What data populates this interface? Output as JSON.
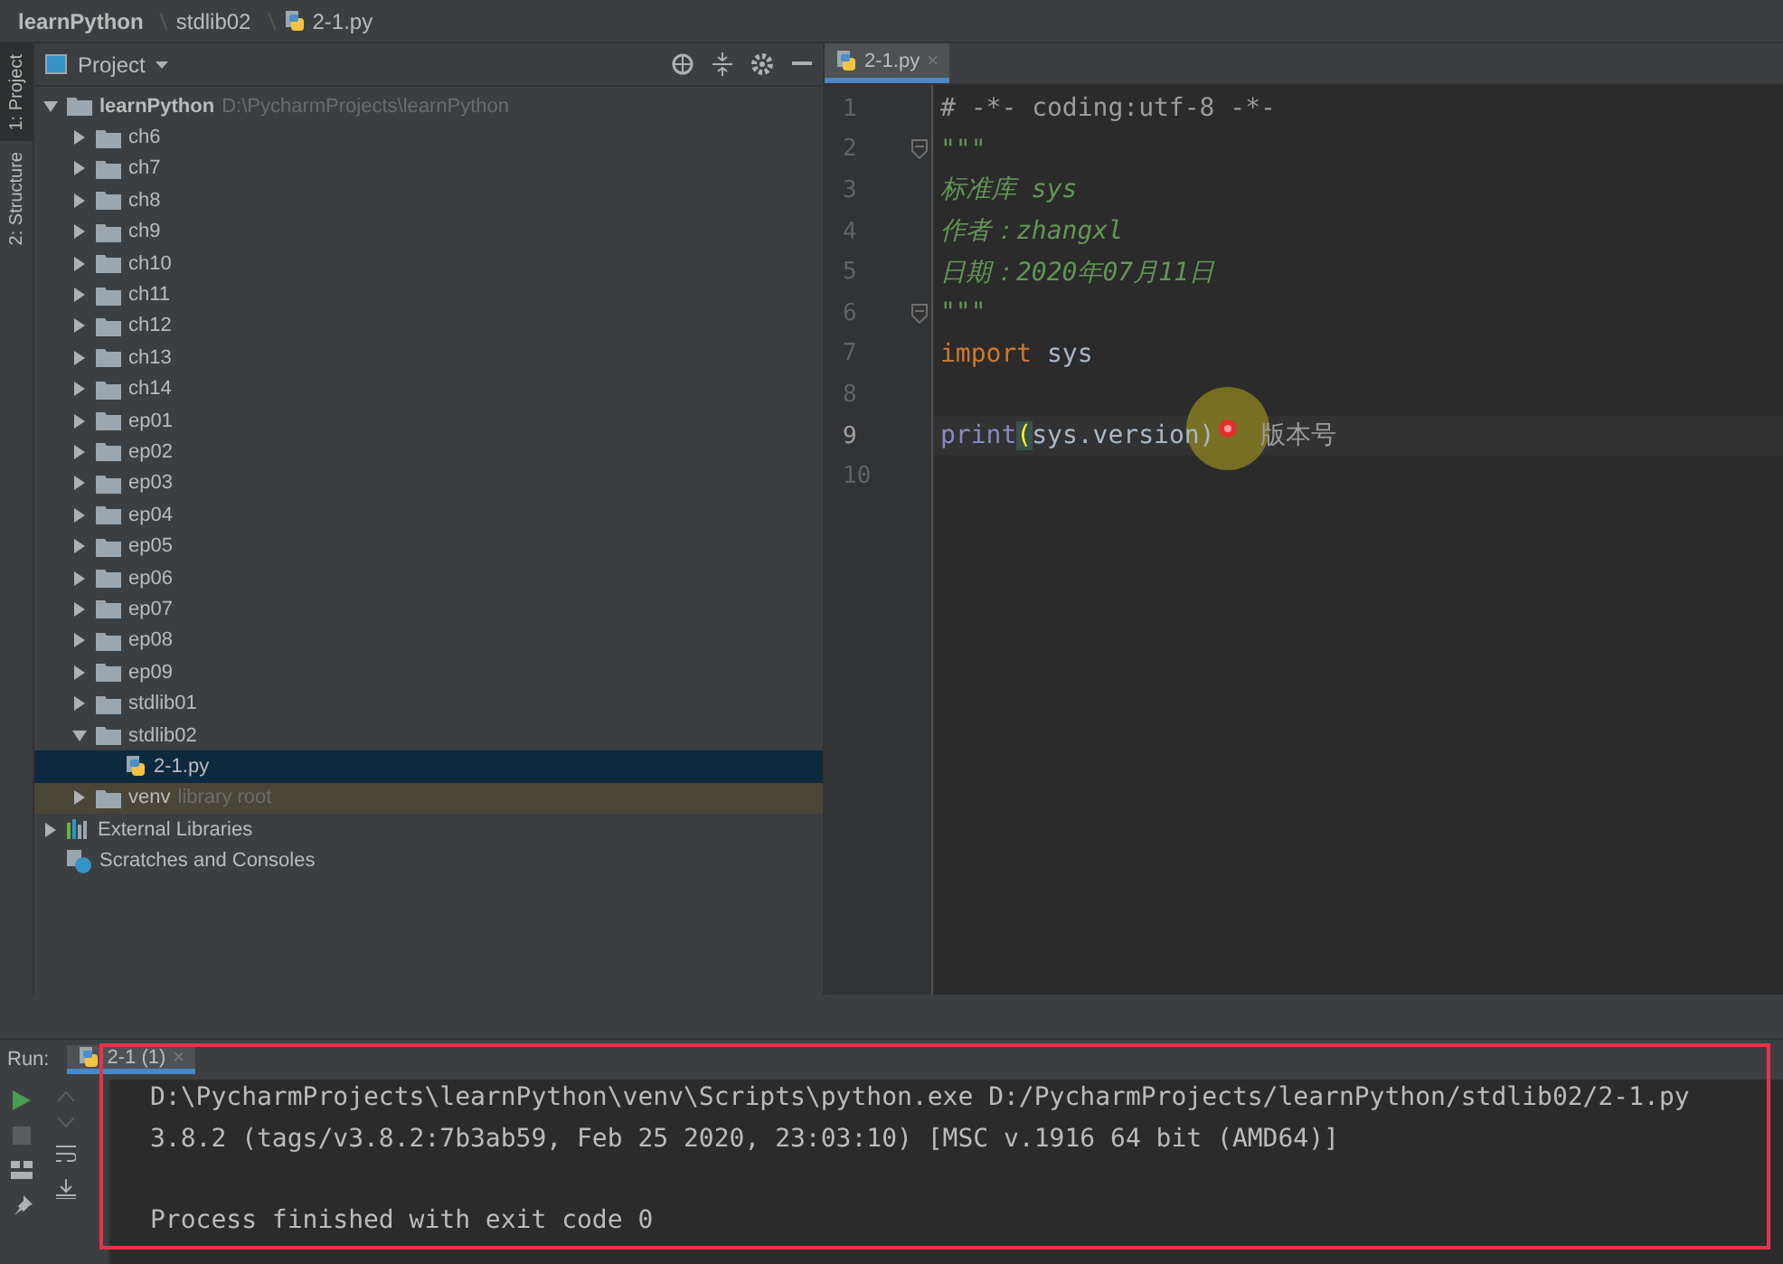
{
  "breadcrumbs": [
    {
      "label": "learnPython",
      "kind": "folder"
    },
    {
      "label": "stdlib02",
      "kind": "folder"
    },
    {
      "label": "2-1.py",
      "kind": "python-file"
    }
  ],
  "tool_strip": [
    {
      "label": "1: Project",
      "selected": true
    },
    {
      "label": "2: Structure",
      "selected": false
    }
  ],
  "project_panel": {
    "title": "Project",
    "tree": [
      {
        "label": "learnPython",
        "note": "D:\\PycharmProjects\\learnPython",
        "kind": "folder",
        "expanded": true,
        "selected": false,
        "bold": true,
        "children": [
          {
            "label": "ch6",
            "kind": "folder",
            "expanded": false,
            "selected": false
          },
          {
            "label": "ch7",
            "kind": "folder",
            "expanded": false,
            "selected": false
          },
          {
            "label": "ch8",
            "kind": "folder",
            "expanded": false,
            "selected": false
          },
          {
            "label": "ch9",
            "kind": "folder",
            "expanded": false,
            "selected": false
          },
          {
            "label": "ch10",
            "kind": "folder",
            "expanded": false,
            "selected": false
          },
          {
            "label": "ch11",
            "kind": "folder",
            "expanded": false,
            "selected": false
          },
          {
            "label": "ch12",
            "kind": "folder",
            "expanded": false,
            "selected": false
          },
          {
            "label": "ch13",
            "kind": "folder",
            "expanded": false,
            "selected": false
          },
          {
            "label": "ch14",
            "kind": "folder",
            "expanded": false,
            "selected": false
          },
          {
            "label": "ep01",
            "kind": "folder",
            "expanded": false,
            "selected": false
          },
          {
            "label": "ep02",
            "kind": "folder",
            "expanded": false,
            "selected": false
          },
          {
            "label": "ep03",
            "kind": "folder",
            "expanded": false,
            "selected": false
          },
          {
            "label": "ep04",
            "kind": "folder",
            "expanded": false,
            "selected": false
          },
          {
            "label": "ep05",
            "kind": "folder",
            "expanded": false,
            "selected": false
          },
          {
            "label": "ep06",
            "kind": "folder",
            "expanded": false,
            "selected": false
          },
          {
            "label": "ep07",
            "kind": "folder",
            "expanded": false,
            "selected": false
          },
          {
            "label": "ep08",
            "kind": "folder",
            "expanded": false,
            "selected": false
          },
          {
            "label": "ep09",
            "kind": "folder",
            "expanded": false,
            "selected": false
          },
          {
            "label": "stdlib01",
            "kind": "folder",
            "expanded": false,
            "selected": false
          },
          {
            "label": "stdlib02",
            "kind": "folder",
            "expanded": true,
            "selected": false,
            "children": [
              {
                "label": "2-1.py",
                "kind": "python-file",
                "selected": true
              }
            ]
          },
          {
            "label": "venv",
            "note": "library root",
            "kind": "library-folder",
            "expanded": false,
            "selected": false
          }
        ]
      },
      {
        "label": "External Libraries",
        "kind": "libraries",
        "expanded": false,
        "selected": false
      },
      {
        "label": "Scratches and Consoles",
        "kind": "scratches",
        "selected": false
      }
    ]
  },
  "editor": {
    "tabs": [
      {
        "label": "2-1.py",
        "selected": true,
        "close": "×"
      }
    ],
    "lines": [
      {
        "number": "1",
        "fold": false,
        "current": false,
        "tokens": [
          {
            "text": "# -*- coding:utf-8 -*-",
            "kind": "comment"
          }
        ]
      },
      {
        "number": "2",
        "fold": true,
        "current": false,
        "tokens": [
          {
            "text": "\"\"\"",
            "kind": "docstring"
          }
        ]
      },
      {
        "number": "3",
        "fold": false,
        "current": false,
        "tokens": [
          {
            "text": "标准库 sys",
            "kind": "docstring"
          }
        ]
      },
      {
        "number": "4",
        "fold": false,
        "current": false,
        "tokens": [
          {
            "text": "作者：zhangxl",
            "kind": "docstring"
          }
        ]
      },
      {
        "number": "5",
        "fold": false,
        "current": false,
        "tokens": [
          {
            "text": "日期：2020年07月11日",
            "kind": "docstring"
          }
        ]
      },
      {
        "number": "6",
        "fold": true,
        "current": false,
        "tokens": [
          {
            "text": "\"\"\"",
            "kind": "docstring"
          }
        ]
      },
      {
        "number": "7",
        "fold": false,
        "current": false,
        "tokens": [
          {
            "text": "import",
            "kind": "keyword"
          },
          {
            "text": " sys",
            "kind": "plain"
          }
        ]
      },
      {
        "number": "8",
        "fold": false,
        "current": false
      },
      {
        "number": "9",
        "fold": false,
        "current": true,
        "tokens": [
          {
            "text": "print",
            "kind": "builtin"
          },
          {
            "text": "(",
            "kind": "brace-match"
          },
          {
            "text": "sys.version)",
            "kind": "plain"
          },
          {
            "text": "   版本号",
            "kind": "comment"
          }
        ]
      },
      {
        "number": "10",
        "fold": false,
        "current": false
      }
    ]
  },
  "run_panel": {
    "label": "Run:",
    "tabs": [
      {
        "label": "2-1 (1)",
        "selected": true,
        "close": "×"
      }
    ],
    "output": [
      "D:\\PycharmProjects\\learnPython\\venv\\Scripts\\python.exe D:/PycharmProjects/learnPython/stdlib02/2-1.py",
      "3.8.2 (tags/v3.8.2:7b3ab59, Feb 25 2020, 23:03:10) [MSC v.1916 64 bit (AMD64)]"
    ],
    "exit_message": "Process finished with exit code 0"
  }
}
